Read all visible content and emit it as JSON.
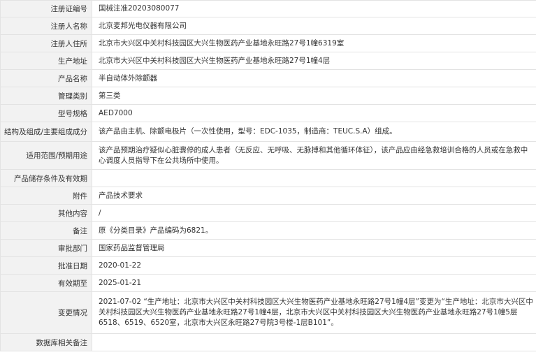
{
  "rows": [
    {
      "label": "注册证编号",
      "value": "国械注准20203080077"
    },
    {
      "label": "注册人名称",
      "value": "北京麦邦光电仪器有限公司"
    },
    {
      "label": "注册人住所",
      "value": "北京市大兴区中关村科技园区大兴生物医药产业基地永旺路27号1幢6319室"
    },
    {
      "label": "生产地址",
      "value": "北京市大兴区中关村科技园区大兴生物医药产业基地永旺路27号1幢4层"
    },
    {
      "label": "产品名称",
      "value": "半自动体外除颤器"
    },
    {
      "label": "管理类别",
      "value": "第三类"
    },
    {
      "label": "型号规格",
      "value": "AED7000"
    },
    {
      "label": "结构及组成/主要组成成分",
      "value": "该产品由主机、除颤电极片（一次性使用，型号：EDC-1035，制造商：TEUC.S.A）组成。"
    },
    {
      "label": "适用范围/预期用途",
      "value": "该产品预期治疗疑似心脏骤停的成人患者（无反应、无呼吸、无脉搏和其他循环体征），该产品应由经急救培训合格的人员或在急救中心调度人员指导下在公共场所中使用。"
    },
    {
      "label": "产品储存条件及有效期",
      "value": ""
    },
    {
      "label": "附件",
      "value": "产品技术要求"
    },
    {
      "label": "其他内容",
      "value": "/"
    },
    {
      "label": "备注",
      "value": "原《分类目录》产品编码为6821。"
    },
    {
      "label": "审批部门",
      "value": "国家药品监督管理局"
    },
    {
      "label": "批准日期",
      "value": "2020-01-22"
    },
    {
      "label": "有效期至",
      "value": "2025-01-21"
    },
    {
      "label": "变更情况",
      "value": "2021-07-02 “生产地址：北京市大兴区中关村科技园区大兴生物医药产业基地永旺路27号1幢4层”变更为“生产地址：北京市大兴区中关村科技园区大兴生物医药产业基地永旺路27号1幢4层，北京市大兴区中关村科技园区大兴生物医药产业基地永旺路27号1幢5层6518、6519、6520室，北京市大兴区永旺路27号院3号楼-1层B101”。"
    },
    {
      "label": "数据库相关备注",
      "value": ""
    }
  ]
}
